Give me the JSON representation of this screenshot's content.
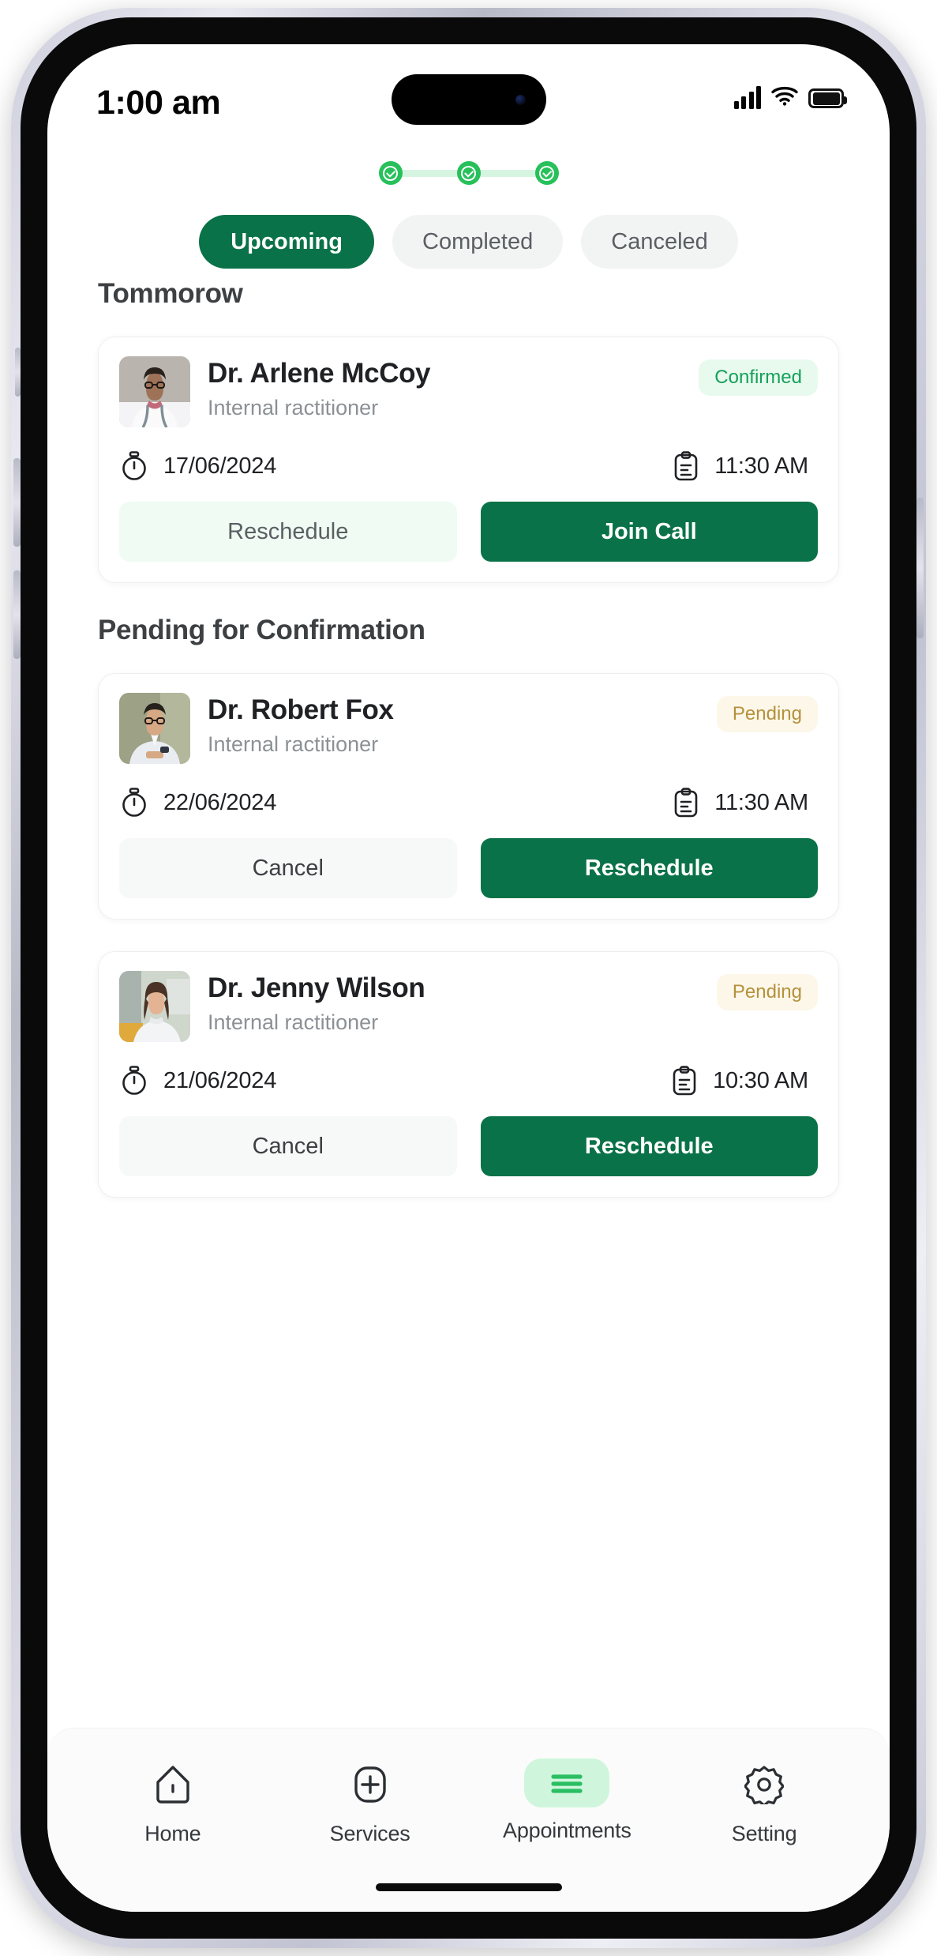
{
  "statusbar": {
    "time": "1:00 am",
    "icons": [
      "signal-icon",
      "wifi-icon",
      "battery-icon"
    ]
  },
  "stepper": {
    "steps": 3,
    "completed_icon": "check-circle-icon",
    "active_color": "#27C05A",
    "track_color": "#D6F5E0"
  },
  "tabs": {
    "items": [
      {
        "label": "Upcoming",
        "active": true
      },
      {
        "label": "Completed",
        "active": false
      },
      {
        "label": "Canceled",
        "active": false
      }
    ],
    "active_bg": "#0A7248",
    "inactive_bg": "#F2F3F3"
  },
  "sections": [
    {
      "title": "Tommorow",
      "cards": [
        {
          "name": "Dr. Arlene McCoy",
          "role": "Internal ractitioner",
          "badge": "Confirmed",
          "badge_type": "confirmed",
          "date": "17/06/2024",
          "time": "11:30 AM",
          "date_icon": "stopwatch-icon",
          "time_icon": "clipboard-icon",
          "primary_action": "Join Call",
          "secondary_action": "Reschedule",
          "secondary_style": "soft-green",
          "avatar_alt": "doctor-arlene-mccoy-photo"
        }
      ]
    },
    {
      "title": "Pending for Confirmation",
      "cards": [
        {
          "name": "Dr. Robert Fox",
          "role": "Internal ractitioner",
          "badge": "Pending",
          "badge_type": "pending",
          "date": "22/06/2024",
          "time": "11:30 AM",
          "date_icon": "stopwatch-icon",
          "time_icon": "clipboard-icon",
          "primary_action": "Reschedule",
          "secondary_action": "Cancel",
          "secondary_style": "soft-grey",
          "avatar_alt": "doctor-robert-fox-photo"
        },
        {
          "name": "Dr. Jenny Wilson",
          "role": "Internal ractitioner",
          "badge": "Pending",
          "badge_type": "pending",
          "date": "21/06/2024",
          "time": "10:30 AM",
          "date_icon": "stopwatch-icon",
          "time_icon": "clipboard-icon",
          "primary_action": "Reschedule",
          "secondary_action": "Cancel",
          "secondary_style": "soft-grey",
          "avatar_alt": "doctor-jenny-wilson-photo"
        }
      ]
    }
  ],
  "bottom_nav": {
    "items": [
      {
        "label": "Home",
        "icon": "home-icon",
        "active": false
      },
      {
        "label": "Services",
        "icon": "plus-square-icon",
        "active": false
      },
      {
        "label": "Appointments",
        "icon": "menu-lines-icon",
        "active": true
      },
      {
        "label": "Setting",
        "icon": "gear-icon",
        "active": false
      }
    ],
    "active_pill_color": "#CFF6DC",
    "active_icon_color": "#2BBE62"
  },
  "colors": {
    "brand_green": "#0A7248",
    "accent_green": "#27C05A",
    "mint": "#EFFBF3",
    "pending_amber": "#B5913C"
  }
}
